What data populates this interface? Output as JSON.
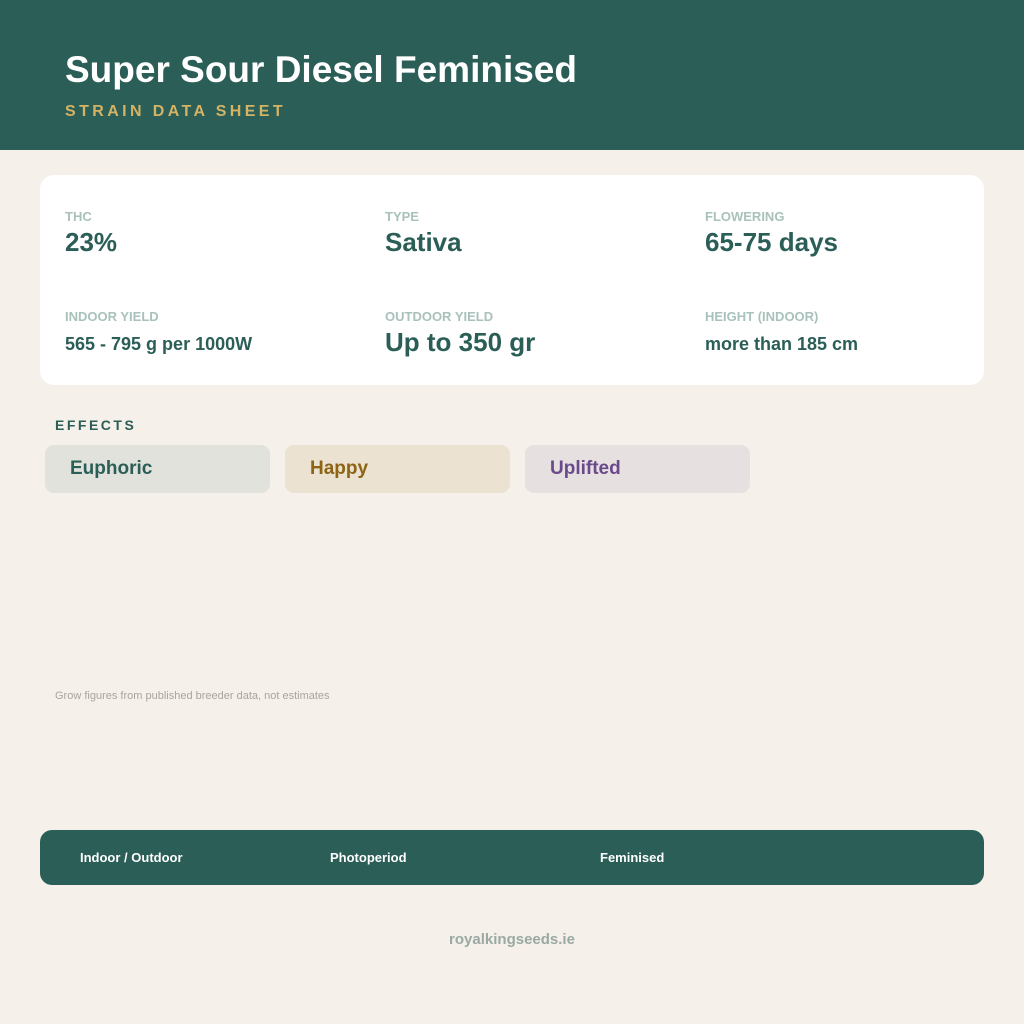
{
  "header": {
    "title": "Super Sour Diesel Feminised",
    "subtitle": "STRAIN DATA SHEET"
  },
  "stats": [
    {
      "label": "THC",
      "value": "23%"
    },
    {
      "label": "TYPE",
      "value": "Sativa"
    },
    {
      "label": "FLOWERING",
      "value": "65-75 days"
    },
    {
      "label": "INDOOR YIELD",
      "value": "565 - 795 g per 1000W"
    },
    {
      "label": "OUTDOOR YIELD",
      "value": "Up to 350 gr"
    },
    {
      "label": "HEIGHT (INDOOR)",
      "value": "more than 185 cm"
    }
  ],
  "effects": {
    "label": "EFFECTS",
    "items": [
      {
        "name": "Euphoric",
        "text_color": "#2a5e57",
        "bg_color": "#e1e2db"
      },
      {
        "name": "Happy",
        "text_color": "#8c6414",
        "bg_color": "#ece2d2"
      },
      {
        "name": "Uplifted",
        "text_color": "#6b4a8c",
        "bg_color": "#e7e0e0"
      }
    ]
  },
  "footnote": "Grow figures from published breeder data, not estimates",
  "bar": {
    "items": [
      "Indoor / Outdoor",
      "Photoperiod",
      "Feminised"
    ]
  },
  "footer": {
    "site": "royalkingseeds.ie"
  },
  "colors": {
    "brand": "#2a5e57",
    "accent": "#d4b464",
    "background": "#f5f0ea"
  }
}
